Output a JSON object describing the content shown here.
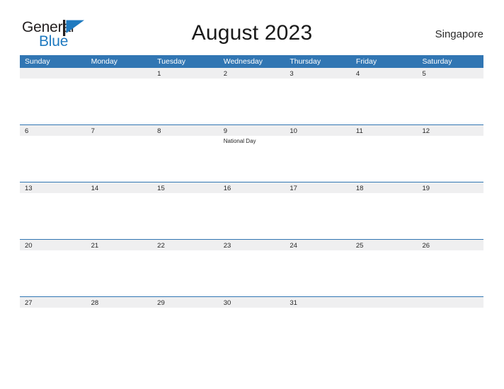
{
  "brand": {
    "name_part1": "General",
    "name_part2": "Blue",
    "mark": "triangle-flag-icon",
    "color_dark": "#231f20",
    "color_blue": "#1f7ac0"
  },
  "header": {
    "title": "August 2023",
    "locale": "Singapore"
  },
  "calendar": {
    "accent_color": "#3176b3",
    "band_color": "#efeff0",
    "weekday_headers": [
      "Sunday",
      "Monday",
      "Tuesday",
      "Wednesday",
      "Thursday",
      "Friday",
      "Saturday"
    ],
    "weeks": [
      [
        {
          "day": "",
          "event": ""
        },
        {
          "day": "",
          "event": ""
        },
        {
          "day": "1",
          "event": ""
        },
        {
          "day": "2",
          "event": ""
        },
        {
          "day": "3",
          "event": ""
        },
        {
          "day": "4",
          "event": ""
        },
        {
          "day": "5",
          "event": ""
        }
      ],
      [
        {
          "day": "6",
          "event": ""
        },
        {
          "day": "7",
          "event": ""
        },
        {
          "day": "8",
          "event": ""
        },
        {
          "day": "9",
          "event": "National Day"
        },
        {
          "day": "10",
          "event": ""
        },
        {
          "day": "11",
          "event": ""
        },
        {
          "day": "12",
          "event": ""
        }
      ],
      [
        {
          "day": "13",
          "event": ""
        },
        {
          "day": "14",
          "event": ""
        },
        {
          "day": "15",
          "event": ""
        },
        {
          "day": "16",
          "event": ""
        },
        {
          "day": "17",
          "event": ""
        },
        {
          "day": "18",
          "event": ""
        },
        {
          "day": "19",
          "event": ""
        }
      ],
      [
        {
          "day": "20",
          "event": ""
        },
        {
          "day": "21",
          "event": ""
        },
        {
          "day": "22",
          "event": ""
        },
        {
          "day": "23",
          "event": ""
        },
        {
          "day": "24",
          "event": ""
        },
        {
          "day": "25",
          "event": ""
        },
        {
          "day": "26",
          "event": ""
        }
      ],
      [
        {
          "day": "27",
          "event": ""
        },
        {
          "day": "28",
          "event": ""
        },
        {
          "day": "29",
          "event": ""
        },
        {
          "day": "30",
          "event": ""
        },
        {
          "day": "31",
          "event": ""
        },
        {
          "day": "",
          "event": ""
        },
        {
          "day": "",
          "event": ""
        }
      ]
    ]
  }
}
